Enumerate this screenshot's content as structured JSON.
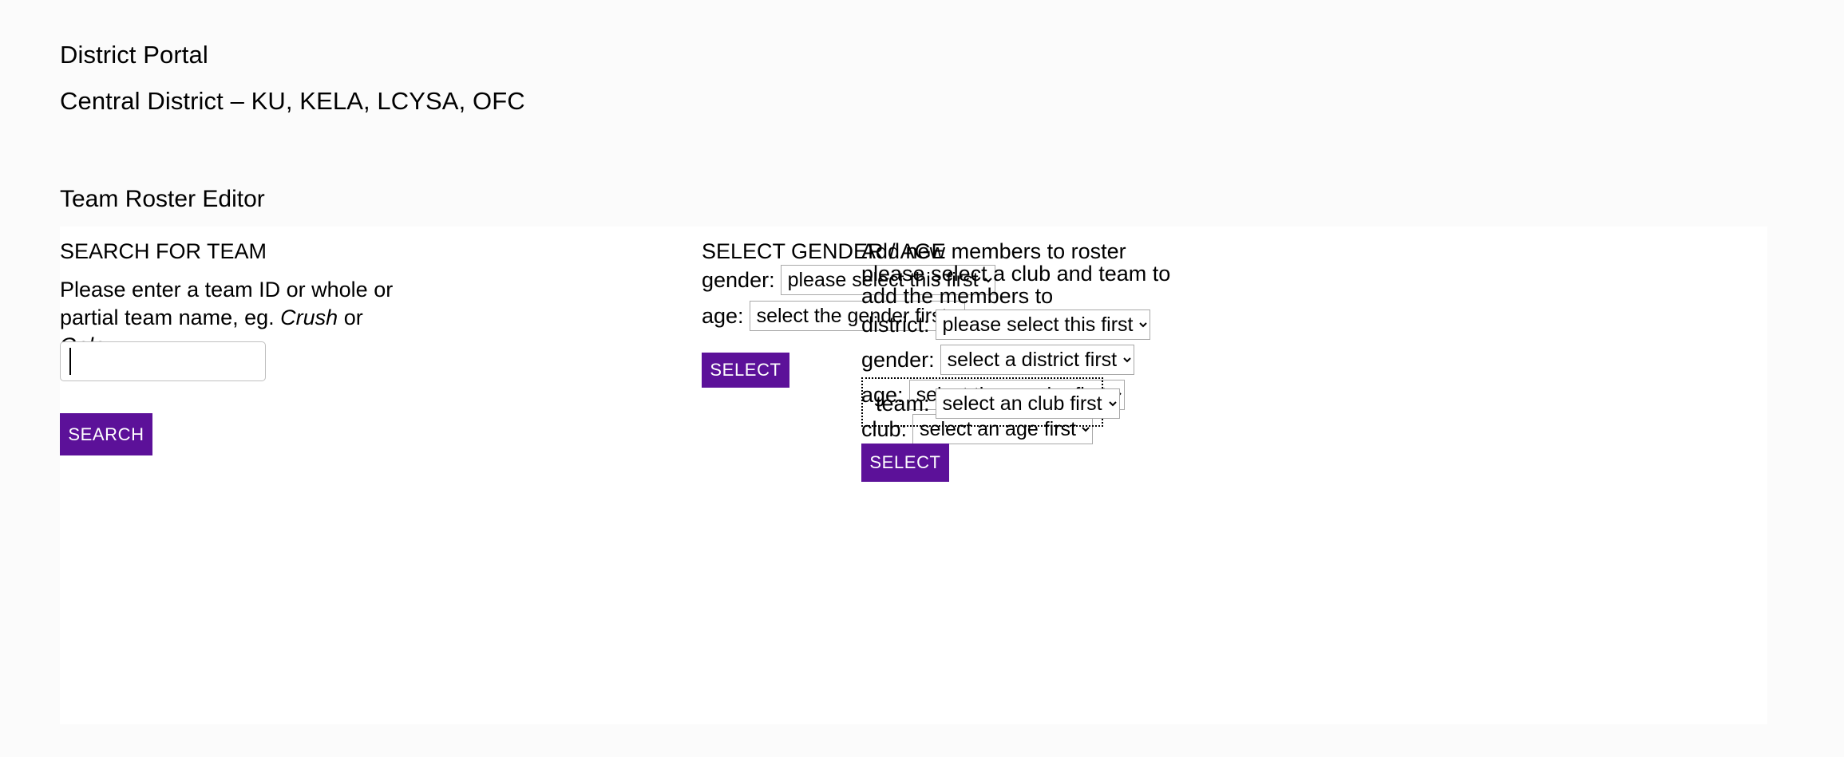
{
  "header": {
    "title": "District Portal",
    "subtitle": "Central District – KU, KELA, LCYSA, OFC"
  },
  "section_title": "Team Roster Editor",
  "search_column": {
    "heading": "SEARCH FOR TEAM",
    "help_prefix": "Please enter a team ID or whole or partial team name, eg. ",
    "help_example_1": "Crush",
    "help_conjunction": " or ",
    "help_example_2": "Galaxy",
    "input_value": "",
    "input_placeholder": "",
    "search_button_label": "SEARCH"
  },
  "gender_age_column": {
    "heading": "SELECT GENDER / AGE",
    "gender_label": "gender:",
    "gender_value": "please select this first",
    "age_label": "age:",
    "age_value": "select the gender first",
    "select_button_label": "SELECT"
  },
  "roster_column": {
    "heading": "Add new members to roster",
    "subtext": "please select a club and team to add the members to",
    "district_label": "district:",
    "district_value": "please select this first",
    "gender_label": "gender:",
    "gender_value": "select a district first",
    "age_label": "age:",
    "age_value": "select the gender first",
    "club_label": "club:",
    "club_value": "select an age first",
    "team_label": "team:",
    "team_value": "select an club first",
    "select_button_label": "SELECT"
  },
  "colors": {
    "accent_purple": "#5c1199",
    "page_background": "#fbfbfb",
    "panel_background": "#ffffff",
    "control_border": "#a8a8a8",
    "input_border": "#bfbfbf",
    "text": "#000000"
  }
}
